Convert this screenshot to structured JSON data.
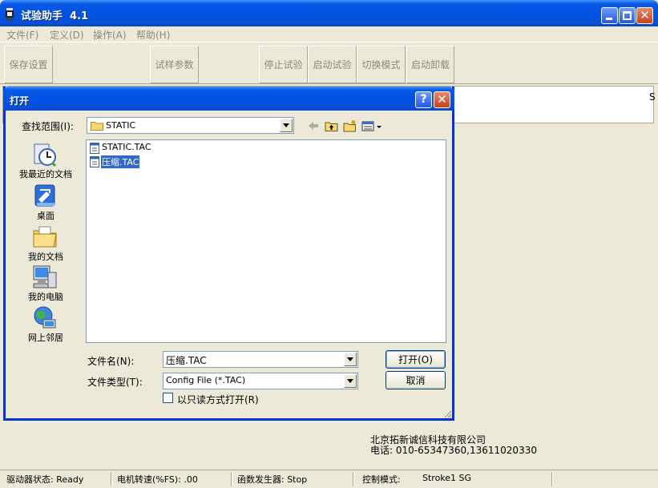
{
  "app": {
    "title": "试验助手  4.1",
    "menu": [
      "文件(F)",
      "定义(D)",
      "操作(A)",
      "帮助(H)"
    ],
    "toolbar": {
      "save": "保存设置",
      "params": "试样参数",
      "stop": "停止试验",
      "start": "启动试验",
      "switch_mode": "切换模式",
      "unload": "启动卸载"
    },
    "panel_char": "S",
    "company": {
      "name": "北京拓新诚信科技有限公司",
      "phone": "电话: 010-65347360,13611020330"
    },
    "statusbar": {
      "driver": "驱动器状态: Ready",
      "motor": "电机转速(%FS): .00",
      "func_gen": "函数发生器: Stop",
      "control_label": "控制模式:",
      "control_value": "Stroke1 SG"
    }
  },
  "dialog": {
    "title": "打开",
    "help_glyph": "?",
    "look_in_label": "查找范围(I):",
    "look_in_value": "STATIC",
    "places": [
      {
        "label": "我最近的文档",
        "icon": "recent-documents-icon"
      },
      {
        "label": "桌面",
        "icon": "desktop-icon"
      },
      {
        "label": "我的文档",
        "icon": "my-documents-icon"
      },
      {
        "label": "我的电脑",
        "icon": "my-computer-icon"
      },
      {
        "label": "网上邻居",
        "icon": "network-places-icon"
      }
    ],
    "files": [
      {
        "name": "STATIC.TAC",
        "selected": false
      },
      {
        "name": "压缩.TAC",
        "selected": true
      }
    ],
    "file_name_label": "文件名(N):",
    "file_name_value": "压缩.TAC",
    "file_type_label": "文件类型(T):",
    "file_type_value": "Config File (*.TAC)",
    "readonly_label": "以只读方式打开(R)",
    "readonly_checked": false,
    "open_button": "打开(O)",
    "cancel_button": "取消"
  },
  "colors": {
    "titlebar": "#0054e3",
    "selection": "#316ac5",
    "face": "#ece9d8"
  }
}
